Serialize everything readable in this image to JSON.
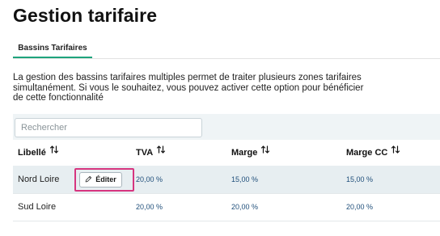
{
  "page": {
    "title": "Gestion tarifaire"
  },
  "tabs": [
    {
      "label": "Bassins Tarifaires",
      "active": true
    }
  ],
  "description": "La gestion des bassins tarifaires multiples permet de traiter plusieurs zones tarifaires simultanément. Si vous le souhaitez, vous pouvez activer cette option pour bénéficier de cette fonctionnalité",
  "search": {
    "placeholder": "Rechercher",
    "value": ""
  },
  "table": {
    "columns": [
      {
        "label": "Libellé",
        "icon": "sort-icon"
      },
      {
        "label": "TVA",
        "icon": "sort-icon"
      },
      {
        "label": "Marge",
        "icon": "sort-icon"
      },
      {
        "label": "Marge CC",
        "icon": "sort-icon"
      }
    ],
    "rows": [
      {
        "name": "Nord Loire",
        "tva": "20,00 %",
        "marge": "15,00 %",
        "marge_cc": "15,00 %",
        "selected": true
      },
      {
        "name": "Sud Loire",
        "tva": "20,00 %",
        "marge": "20,00 %",
        "marge_cc": "20,00 %",
        "selected": false
      }
    ],
    "edit_button": {
      "label": "Éditer",
      "icon": "pencil-icon"
    }
  },
  "colors": {
    "accent": "#1ea47c",
    "highlight": "#d6357f",
    "toolbar_bg": "#eff4f6",
    "selected_row_bg": "#e7eef1",
    "number_text": "#1f4e7a"
  }
}
